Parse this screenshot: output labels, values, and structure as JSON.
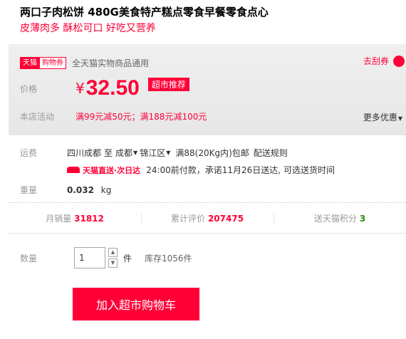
{
  "product": {
    "title": "两口子肉松饼 480G美食特产糕点零食早餐零食点心",
    "subtitle": "皮薄肉多 酥松可口 好吃又营养"
  },
  "coupon": {
    "tag_brand": "天猫",
    "tag_type": "购物券",
    "description": "全天猫实物商品通用",
    "action": "去刮券"
  },
  "price": {
    "label": "价格",
    "currency": "¥",
    "value": "32.50",
    "badge": "超市推荐"
  },
  "activity": {
    "label": "本店活动",
    "text": "满99元减50元；满188元减100元",
    "more": "更多优惠"
  },
  "shipping": {
    "label": "运费",
    "origin": "四川成都",
    "to": "至",
    "city": "成都",
    "district": "锦江区",
    "policy": "满88(20Kg内)包邮",
    "rules": "配送规则",
    "express_brand": "天猫直送·次日达",
    "express_text": "24:00前付款，承诺11月26日送达, 可选送货时间"
  },
  "weight": {
    "label": "重量",
    "value": "0.032",
    "unit": "kg"
  },
  "stats": {
    "monthly_sales_label": "月销量",
    "monthly_sales": "31812",
    "reviews_label": "累计评价",
    "reviews": "207475",
    "points_label": "送天猫积分",
    "points": "3"
  },
  "quantity": {
    "label": "数量",
    "value": "1",
    "unit": "件",
    "stock": "库存1056件"
  },
  "cart_button": "加入超市购物车",
  "colors": {
    "accent": "#ff0036",
    "points_green": "#2a8c00"
  }
}
